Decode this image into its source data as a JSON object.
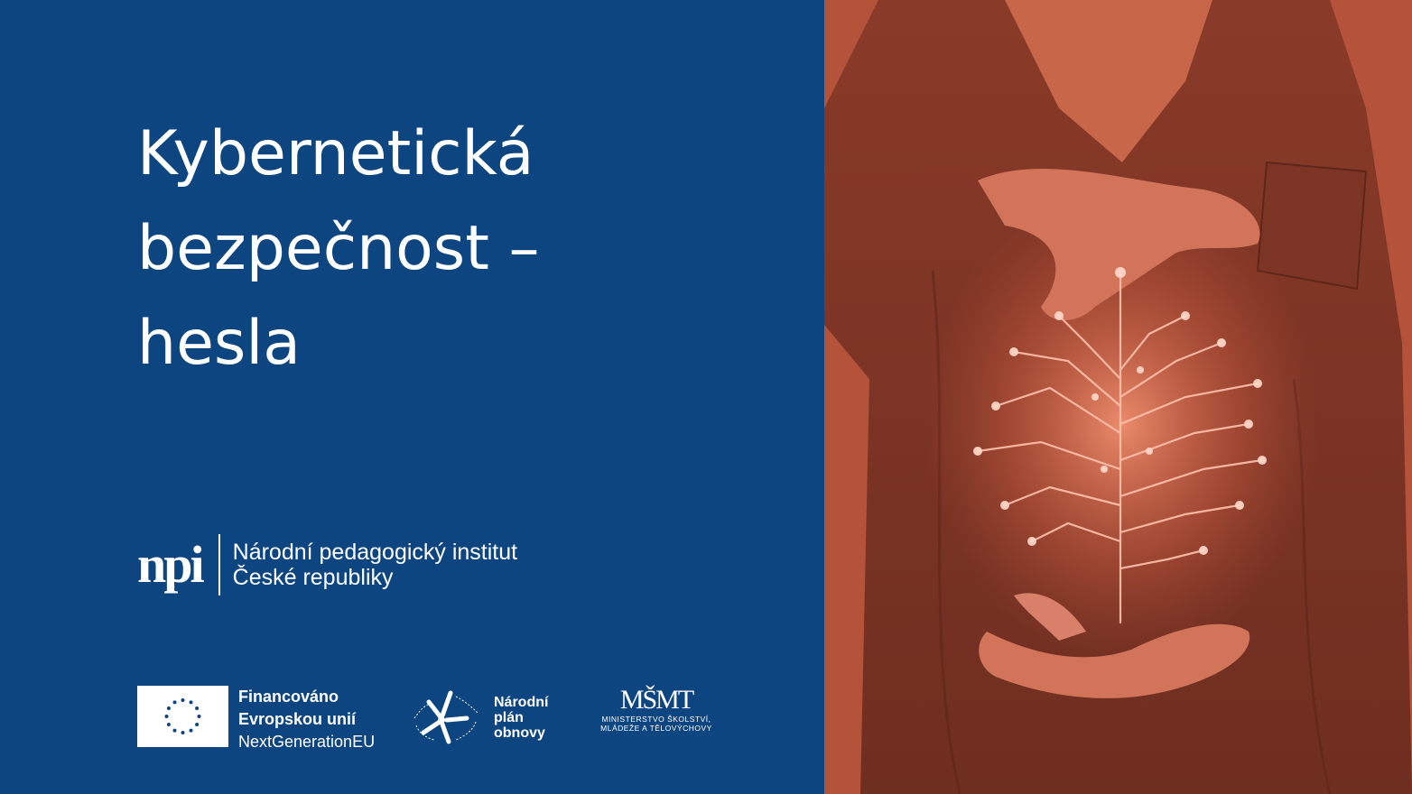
{
  "title": {
    "line1": "Kybernetická",
    "line2": "bezpečnost –",
    "line3": "hesla"
  },
  "npi_logo": {
    "mark": "npi",
    "line1": "Národní pedagogický institut",
    "line2": "České republiky"
  },
  "eu_logo": {
    "line1": "Financováno",
    "line2": "Evropskou unií",
    "line3": "NextGenerationEU"
  },
  "npo_logo": {
    "line1": "Národní",
    "line2": "plán",
    "line3": "obnovy"
  },
  "msmt_logo": {
    "mark": "MŠMT",
    "line1": "MINISTERSTVO ŠKOLSTVÍ,",
    "line2": "MLÁDEŽE A TĚLOVÝCHOVY"
  },
  "colors": {
    "background": "#0c4580",
    "photo_tint": "#c4583e",
    "text": "#ffffff"
  }
}
